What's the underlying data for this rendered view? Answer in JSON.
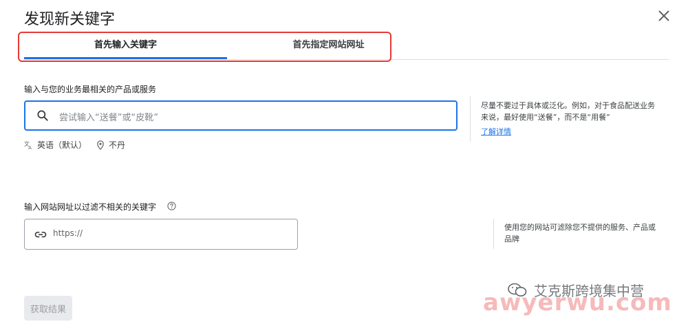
{
  "dialog": {
    "title": "发现新关键字"
  },
  "tabs": [
    {
      "label": "首先输入关键字",
      "active": true
    },
    {
      "label": "首先指定网站网址",
      "active": false
    }
  ],
  "keyword_section": {
    "label": "输入与您的业务最相关的产品或服务",
    "search_placeholder": "尝试输入“送餐”或“皮靴”",
    "language": "英语（默认）",
    "location": "不丹",
    "help_text": "尽量不要过于具体或泛化。例如，对于食品配送业务来说，最好使用“送餐”，而不是“用餐”",
    "learn_more": "了解详情"
  },
  "url_section": {
    "label": "输入网站网址以过滤不相关的关键字",
    "url_placeholder": "https://",
    "help_text": "使用您的网站可滤除您不提供的服务、产品或品牌"
  },
  "actions": {
    "submit_label": "获取结果"
  },
  "watermark": {
    "top_text": "艾克斯跨境集中营",
    "bottom_text": "awyerwu.com"
  },
  "colors": {
    "accent": "#1a73e8",
    "highlight_border": "#e53935",
    "disabled_bg": "#e8eaed"
  }
}
